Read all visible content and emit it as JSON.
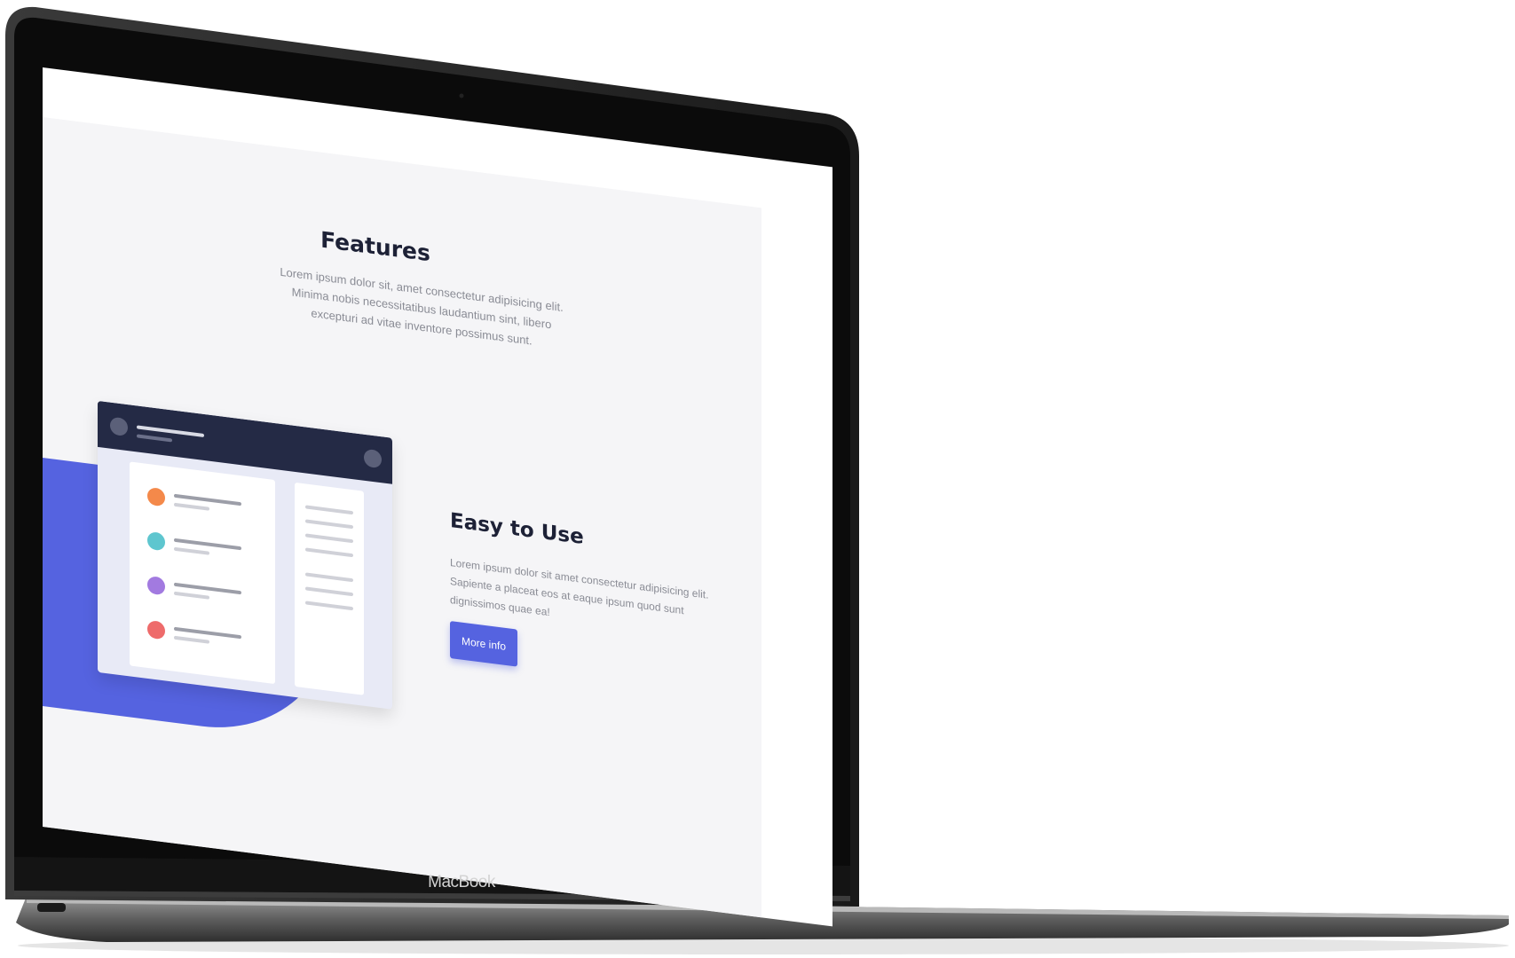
{
  "device": {
    "brand_label": "MacBook"
  },
  "features": {
    "title": "Features",
    "description": "Lorem ipsum dolor sit, amet consectetur adipisicing elit. Minima nobis necessitatibus laudantium sint, libero excepturi ad vitae inventore possimus sunt."
  },
  "easy_to_use": {
    "title": "Easy to Use",
    "description": "Lorem ipsum dolor sit amet consectetur adipisicing elit. Sapiente a placeat eos at eaque ipsum quod sunt dignissimos quae ea!",
    "button_label": "More info"
  },
  "colors": {
    "accent": "#5563e0",
    "dark_navy": "#242a45",
    "list_dot_orange": "#f4894a",
    "list_dot_teal": "#5ec6cf",
    "list_dot_purple": "#a27ae0",
    "list_dot_red": "#ee6b6b"
  }
}
